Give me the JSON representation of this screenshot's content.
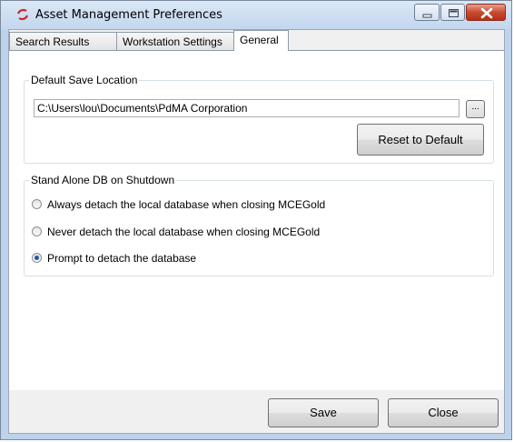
{
  "window": {
    "title": "Asset Management Preferences"
  },
  "tabs": [
    {
      "label": "Search Results",
      "active": false
    },
    {
      "label": "Workstation Settings",
      "active": false
    },
    {
      "label": "General",
      "active": true
    }
  ],
  "default_save": {
    "legend": "Default Save Location",
    "path_value": "C:\\Users\\lou\\Documents\\PdMA Corporation",
    "browse_label": "...",
    "reset_label": "Reset to Default"
  },
  "shutdown": {
    "legend": "Stand Alone DB on Shutdown",
    "options": [
      {
        "label": "Always detach the local database when closing MCEGold",
        "checked": false
      },
      {
        "label": "Never detach the local database when closing MCEGold",
        "checked": false
      },
      {
        "label": "Prompt to detach the database",
        "checked": true
      }
    ]
  },
  "footer": {
    "save_label": "Save",
    "close_label": "Close"
  },
  "colors": {
    "frame": "#bdd3eb",
    "radio_selected": "#1c5aa6",
    "close_button": "#c84a31"
  },
  "icons": [
    "app-logo-icon",
    "minimize-icon",
    "maximize-icon",
    "close-icon"
  ]
}
